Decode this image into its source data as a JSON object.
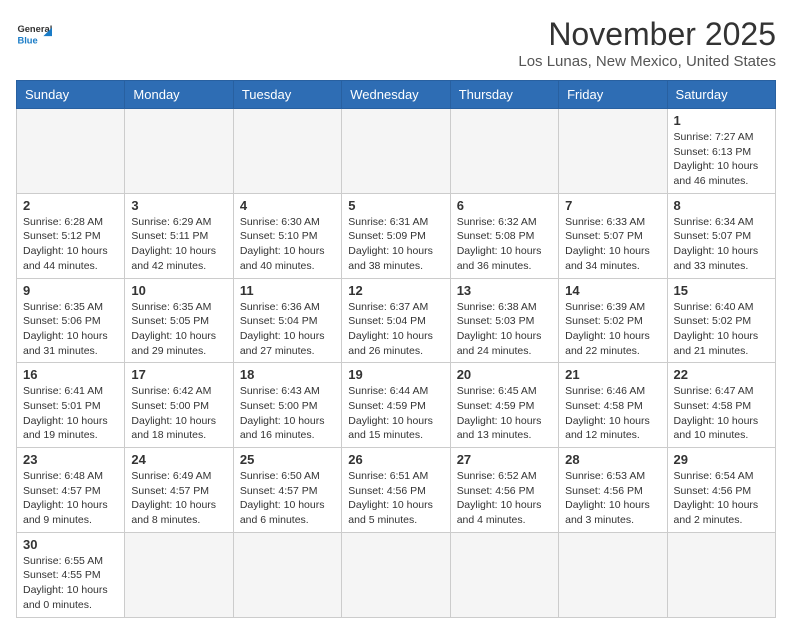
{
  "header": {
    "logo_general": "General",
    "logo_blue": "Blue",
    "month_title": "November 2025",
    "location": "Los Lunas, New Mexico, United States"
  },
  "days_of_week": [
    "Sunday",
    "Monday",
    "Tuesday",
    "Wednesday",
    "Thursday",
    "Friday",
    "Saturday"
  ],
  "weeks": [
    [
      null,
      null,
      null,
      null,
      null,
      null,
      {
        "day": "1",
        "sunrise": "Sunrise: 7:27 AM",
        "sunset": "Sunset: 6:13 PM",
        "daylight": "Daylight: 10 hours and 46 minutes."
      }
    ],
    [
      {
        "day": "2",
        "sunrise": "Sunrise: 6:28 AM",
        "sunset": "Sunset: 5:12 PM",
        "daylight": "Daylight: 10 hours and 44 minutes."
      },
      {
        "day": "3",
        "sunrise": "Sunrise: 6:29 AM",
        "sunset": "Sunset: 5:11 PM",
        "daylight": "Daylight: 10 hours and 42 minutes."
      },
      {
        "day": "4",
        "sunrise": "Sunrise: 6:30 AM",
        "sunset": "Sunset: 5:10 PM",
        "daylight": "Daylight: 10 hours and 40 minutes."
      },
      {
        "day": "5",
        "sunrise": "Sunrise: 6:31 AM",
        "sunset": "Sunset: 5:09 PM",
        "daylight": "Daylight: 10 hours and 38 minutes."
      },
      {
        "day": "6",
        "sunrise": "Sunrise: 6:32 AM",
        "sunset": "Sunset: 5:08 PM",
        "daylight": "Daylight: 10 hours and 36 minutes."
      },
      {
        "day": "7",
        "sunrise": "Sunrise: 6:33 AM",
        "sunset": "Sunset: 5:07 PM",
        "daylight": "Daylight: 10 hours and 34 minutes."
      },
      {
        "day": "8",
        "sunrise": "Sunrise: 6:34 AM",
        "sunset": "Sunset: 5:07 PM",
        "daylight": "Daylight: 10 hours and 33 minutes."
      }
    ],
    [
      {
        "day": "9",
        "sunrise": "Sunrise: 6:35 AM",
        "sunset": "Sunset: 5:06 PM",
        "daylight": "Daylight: 10 hours and 31 minutes."
      },
      {
        "day": "10",
        "sunrise": "Sunrise: 6:35 AM",
        "sunset": "Sunset: 5:05 PM",
        "daylight": "Daylight: 10 hours and 29 minutes."
      },
      {
        "day": "11",
        "sunrise": "Sunrise: 6:36 AM",
        "sunset": "Sunset: 5:04 PM",
        "daylight": "Daylight: 10 hours and 27 minutes."
      },
      {
        "day": "12",
        "sunrise": "Sunrise: 6:37 AM",
        "sunset": "Sunset: 5:04 PM",
        "daylight": "Daylight: 10 hours and 26 minutes."
      },
      {
        "day": "13",
        "sunrise": "Sunrise: 6:38 AM",
        "sunset": "Sunset: 5:03 PM",
        "daylight": "Daylight: 10 hours and 24 minutes."
      },
      {
        "day": "14",
        "sunrise": "Sunrise: 6:39 AM",
        "sunset": "Sunset: 5:02 PM",
        "daylight": "Daylight: 10 hours and 22 minutes."
      },
      {
        "day": "15",
        "sunrise": "Sunrise: 6:40 AM",
        "sunset": "Sunset: 5:02 PM",
        "daylight": "Daylight: 10 hours and 21 minutes."
      }
    ],
    [
      {
        "day": "16",
        "sunrise": "Sunrise: 6:41 AM",
        "sunset": "Sunset: 5:01 PM",
        "daylight": "Daylight: 10 hours and 19 minutes."
      },
      {
        "day": "17",
        "sunrise": "Sunrise: 6:42 AM",
        "sunset": "Sunset: 5:00 PM",
        "daylight": "Daylight: 10 hours and 18 minutes."
      },
      {
        "day": "18",
        "sunrise": "Sunrise: 6:43 AM",
        "sunset": "Sunset: 5:00 PM",
        "daylight": "Daylight: 10 hours and 16 minutes."
      },
      {
        "day": "19",
        "sunrise": "Sunrise: 6:44 AM",
        "sunset": "Sunset: 4:59 PM",
        "daylight": "Daylight: 10 hours and 15 minutes."
      },
      {
        "day": "20",
        "sunrise": "Sunrise: 6:45 AM",
        "sunset": "Sunset: 4:59 PM",
        "daylight": "Daylight: 10 hours and 13 minutes."
      },
      {
        "day": "21",
        "sunrise": "Sunrise: 6:46 AM",
        "sunset": "Sunset: 4:58 PM",
        "daylight": "Daylight: 10 hours and 12 minutes."
      },
      {
        "day": "22",
        "sunrise": "Sunrise: 6:47 AM",
        "sunset": "Sunset: 4:58 PM",
        "daylight": "Daylight: 10 hours and 10 minutes."
      }
    ],
    [
      {
        "day": "23",
        "sunrise": "Sunrise: 6:48 AM",
        "sunset": "Sunset: 4:57 PM",
        "daylight": "Daylight: 10 hours and 9 minutes."
      },
      {
        "day": "24",
        "sunrise": "Sunrise: 6:49 AM",
        "sunset": "Sunset: 4:57 PM",
        "daylight": "Daylight: 10 hours and 8 minutes."
      },
      {
        "day": "25",
        "sunrise": "Sunrise: 6:50 AM",
        "sunset": "Sunset: 4:57 PM",
        "daylight": "Daylight: 10 hours and 6 minutes."
      },
      {
        "day": "26",
        "sunrise": "Sunrise: 6:51 AM",
        "sunset": "Sunset: 4:56 PM",
        "daylight": "Daylight: 10 hours and 5 minutes."
      },
      {
        "day": "27",
        "sunrise": "Sunrise: 6:52 AM",
        "sunset": "Sunset: 4:56 PM",
        "daylight": "Daylight: 10 hours and 4 minutes."
      },
      {
        "day": "28",
        "sunrise": "Sunrise: 6:53 AM",
        "sunset": "Sunset: 4:56 PM",
        "daylight": "Daylight: 10 hours and 3 minutes."
      },
      {
        "day": "29",
        "sunrise": "Sunrise: 6:54 AM",
        "sunset": "Sunset: 4:56 PM",
        "daylight": "Daylight: 10 hours and 2 minutes."
      }
    ],
    [
      {
        "day": "30",
        "sunrise": "Sunrise: 6:55 AM",
        "sunset": "Sunset: 4:55 PM",
        "daylight": "Daylight: 10 hours and 0 minutes."
      },
      null,
      null,
      null,
      null,
      null,
      null
    ]
  ]
}
